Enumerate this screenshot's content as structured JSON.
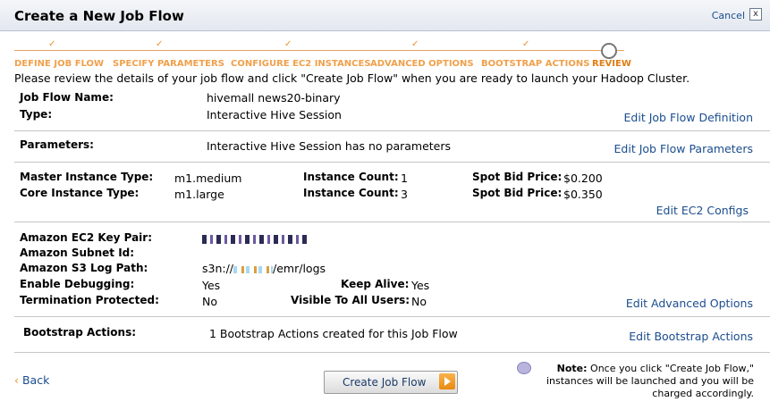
{
  "header": {
    "title": "Create a New Job Flow",
    "cancel_label": "Cancel",
    "close_glyph": "x"
  },
  "steps": [
    {
      "label": "DEFINE JOB FLOW",
      "done": true
    },
    {
      "label": "SPECIFY PARAMETERS",
      "done": true
    },
    {
      "label": "CONFIGURE EC2 INSTANCES",
      "done": true
    },
    {
      "label": "ADVANCED OPTIONS",
      "done": true
    },
    {
      "label": "BOOTSTRAP ACTIONS",
      "done": true
    },
    {
      "label": "REVIEW",
      "done": false,
      "current": true
    }
  ],
  "intro": "Please review the details of your job flow and click \"Create Job Flow\" when you are ready to launch your Hadoop Cluster.",
  "job_flow": {
    "name_label": "Job Flow Name:",
    "name_value": "hivemall news20-binary",
    "type_label": "Type:",
    "type_value": "Interactive Hive Session",
    "edit_label": "Edit Job Flow Definition"
  },
  "parameters": {
    "label": "Parameters:",
    "value": "Interactive Hive Session has no parameters",
    "edit_label": "Edit Job Flow Parameters"
  },
  "ec2": {
    "master_label": "Master Instance Type:",
    "master_value": "m1.medium",
    "core_label": "Core Instance Type:",
    "core_value": "m1.large",
    "count_label": "Instance Count:",
    "master_count": "1",
    "core_count": "3",
    "spot_label": "Spot Bid Price:",
    "master_spot": "$0.200",
    "core_spot": "$0.350",
    "edit_label": "Edit EC2 Configs"
  },
  "advanced": {
    "key_pair_label": "Amazon EC2 Key Pair:",
    "subnet_label": "Amazon Subnet Id:",
    "s3_label": "Amazon S3 Log Path:",
    "s3_prefix": "s3n://",
    "s3_suffix": "/emr/logs",
    "debug_label": "Enable Debugging:",
    "debug_value": "Yes",
    "keepalive_label": "Keep Alive:",
    "keepalive_value": "Yes",
    "termination_label": "Termination Protected:",
    "termination_value": "No",
    "visible_label": "Visible To All Users:",
    "visible_value": "No",
    "edit_label": "Edit Advanced Options"
  },
  "bootstrap": {
    "label": "Bootstrap Actions:",
    "value": "1 Bootstrap Actions created for this Job Flow",
    "edit_label": "Edit Bootstrap Actions"
  },
  "footer": {
    "back_glyph": "‹",
    "back_label": "Back",
    "create_label": "Create Job Flow",
    "note_bold": "Note:",
    "note_text": "Once you click \"Create Job Flow,\" instances will be launched and you will be charged accordingly."
  }
}
